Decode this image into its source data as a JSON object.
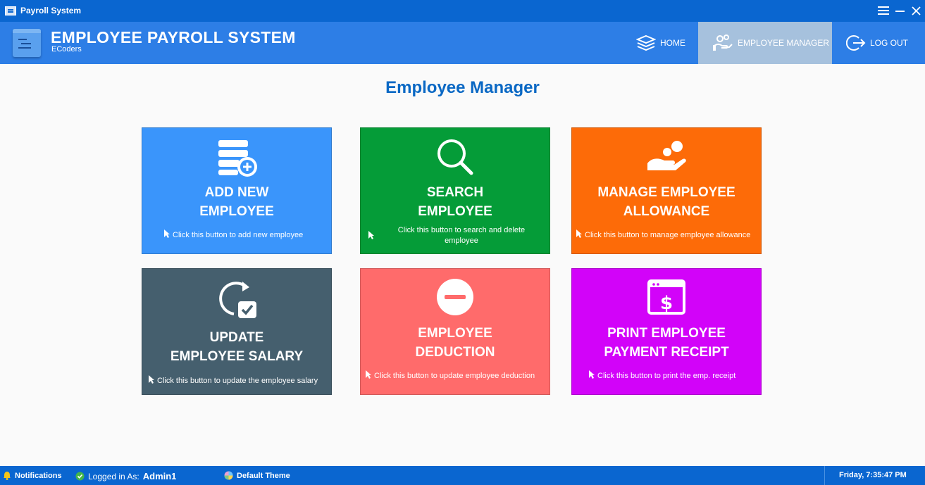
{
  "window": {
    "title": "Payroll System"
  },
  "header": {
    "title": "EMPLOYEE PAYROLL SYSTEM",
    "subtitle": "ECoders",
    "nav": [
      {
        "label": "HOME",
        "icon": "stack-icon"
      },
      {
        "label": "EMPLOYEE MANAGER",
        "icon": "hand-gears-icon",
        "active": true
      },
      {
        "label": "LOG OUT",
        "icon": "logout-icon"
      }
    ]
  },
  "main": {
    "title": "Employee Manager",
    "tiles": [
      {
        "label1": "ADD NEW",
        "label2": "EMPLOYEE",
        "hint": "Click this button to add new employee",
        "color": "#3a95fb",
        "icon": "add-list-icon"
      },
      {
        "label1": "SEARCH",
        "label2": "EMPLOYEE",
        "hint": "Click this button to search and delete employee",
        "color": "#059c38",
        "icon": "search-icon"
      },
      {
        "label1": "MANAGE EMPLOYEE",
        "label2": "ALLOWANCE",
        "hint": "Click this button to manage employee allowance",
        "color": "#fd6b08",
        "icon": "hand-coin-icon"
      },
      {
        "label1": "UPDATE",
        "label2": "EMPLOYEE SALARY",
        "hint": "Click this button to update the employee salary",
        "color": "#455f6e",
        "icon": "refresh-check-icon"
      },
      {
        "label1": "EMPLOYEE",
        "label2": "DEDUCTION",
        "hint": "Click this button to update employee deduction",
        "color": "#ff6b6b",
        "icon": "minus-circle-icon"
      },
      {
        "label1": "PRINT EMPLOYEE",
        "label2": "PAYMENT RECEIPT",
        "hint": "Click this button to print the emp. receipt",
        "color": "#d203f9",
        "icon": "dollar-window-icon"
      }
    ]
  },
  "status": {
    "notifications": "Notifications",
    "logged_in_label": "Logged in As:",
    "user": "Admin1",
    "theme": "Default Theme",
    "datetime": "Friday, 7:35:47 PM"
  },
  "colors": {
    "titlebar": "#0a66d0",
    "header": "#2d7ee6",
    "nav_active": "#a6c1dd",
    "page_title": "#0a68c4"
  }
}
